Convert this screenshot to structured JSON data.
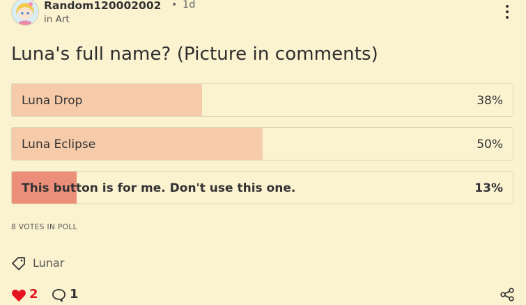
{
  "post": {
    "username": "Random120002002",
    "separator": "•",
    "age": "1d",
    "community": "in Art",
    "title": "Luna's full name? (Picture in comments)"
  },
  "poll": {
    "options": [
      {
        "label": "Luna Drop",
        "percent_text": "38%",
        "percent": 38,
        "selected": false
      },
      {
        "label": "Luna Eclipse",
        "percent_text": "50%",
        "percent": 50,
        "selected": false
      },
      {
        "label": "This button is for me. Don't use this one.",
        "percent_text": "13%",
        "percent": 13,
        "selected": true
      }
    ],
    "votes_text": "8 VOTES IN POLL"
  },
  "tag": {
    "label": "Lunar"
  },
  "actions": {
    "likes": "2",
    "comments": "1"
  },
  "colors": {
    "background": "#fbf2d0",
    "option_fill": "#f6cba9",
    "selected_fill": "#ec8f7a",
    "like": "#e4151f"
  },
  "icons": {
    "more": "more-vertical-icon",
    "tag": "tag-icon",
    "like": "heart-icon",
    "comment": "comment-icon",
    "share": "share-icon"
  }
}
